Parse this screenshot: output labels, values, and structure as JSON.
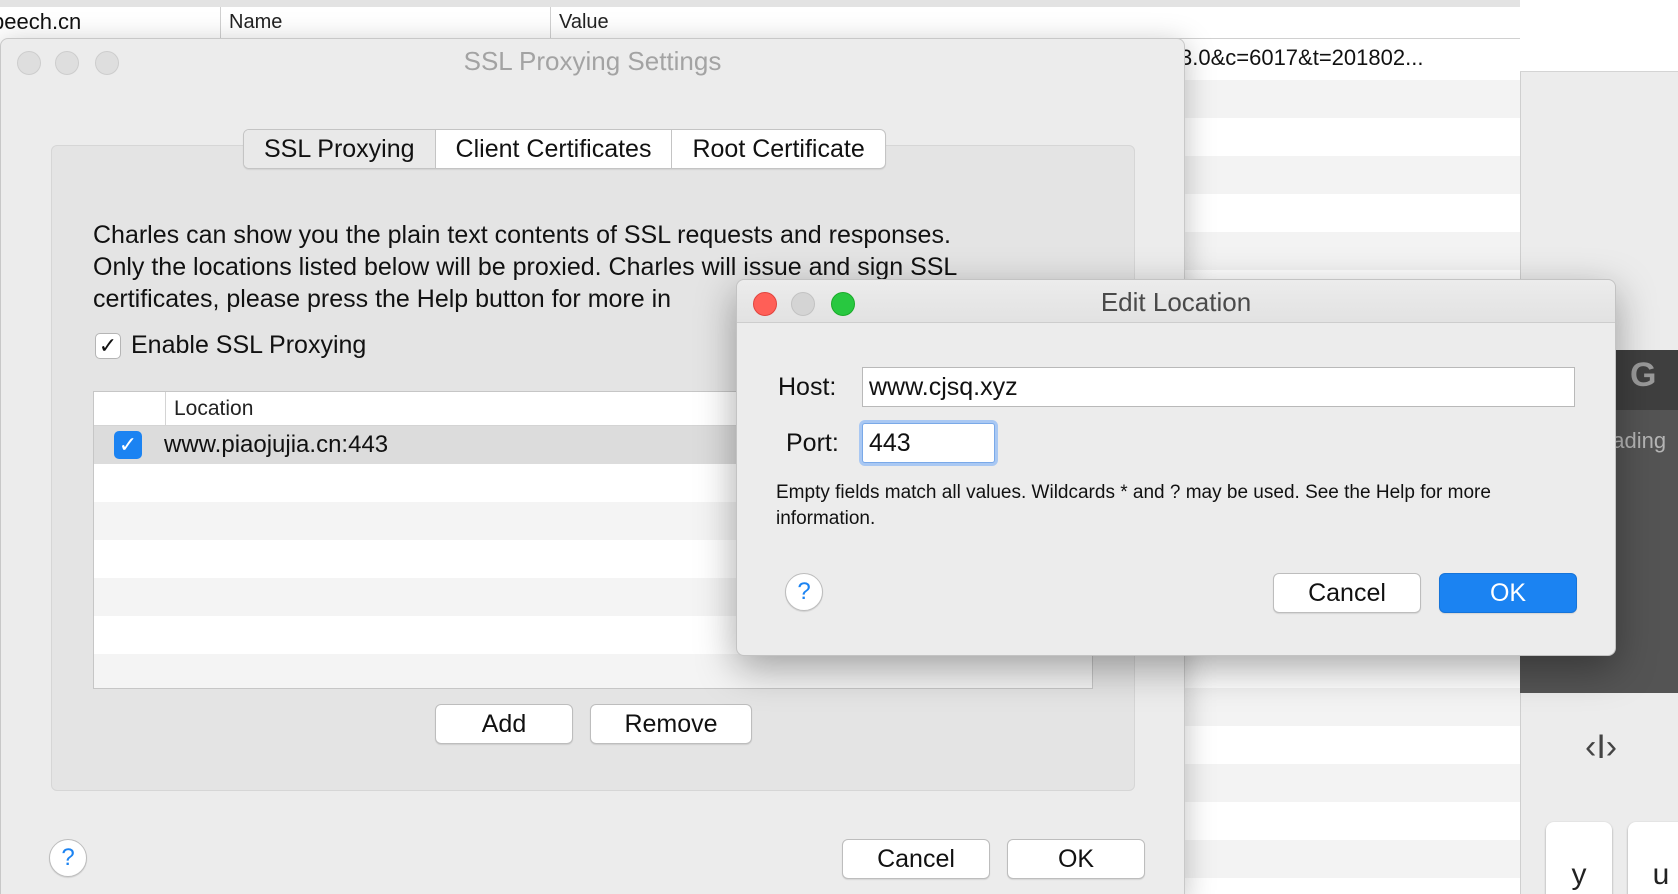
{
  "background": {
    "host_cell": "peech.cn",
    "columns": {
      "name": "Name",
      "value": "Value"
    },
    "url_value": "3.0&c=6017&t=201802...",
    "dark_panel_letter": "G",
    "dark_panel_text": "eading",
    "cursor_glyph": "‹I›",
    "keys": [
      "y",
      "u"
    ]
  },
  "ssl_window": {
    "title": "SSL Proxying Settings",
    "tabs": [
      {
        "label": "SSL Proxying",
        "active": true
      },
      {
        "label": "Client Certificates",
        "active": false
      },
      {
        "label": "Root Certificate",
        "active": false
      }
    ],
    "description_lines": [
      "Charles can show you the plain text contents of SSL requests and responses.",
      "Only the locations listed below will be proxied. Charles will issue and sign SSL",
      "certificates, please press the Help button for more in"
    ],
    "enable_checkbox": {
      "checked": true,
      "glyph": "✓",
      "label": "Enable SSL Proxying"
    },
    "table": {
      "column_location": "Location",
      "rows": [
        {
          "enabled": true,
          "glyph": "✓",
          "location": "www.piaojujia.cn:443"
        }
      ]
    },
    "add_button": "Add",
    "remove_button": "Remove",
    "help_button": "?",
    "cancel_button": "Cancel",
    "ok_button": "OK"
  },
  "edit_dialog": {
    "title": "Edit Location",
    "host_label": "Host:",
    "host_value": "www.cjsq.xyz",
    "port_label": "Port:",
    "port_value": "443",
    "note": "Empty fields match all values. Wildcards * and ? may be used. See the Help for more information.",
    "help_button": "?",
    "cancel_button": "Cancel",
    "ok_button": "OK"
  },
  "colors": {
    "accent_blue": "#1b83f2",
    "close_red": "#ff5f57",
    "zoom_green": "#28c840"
  }
}
